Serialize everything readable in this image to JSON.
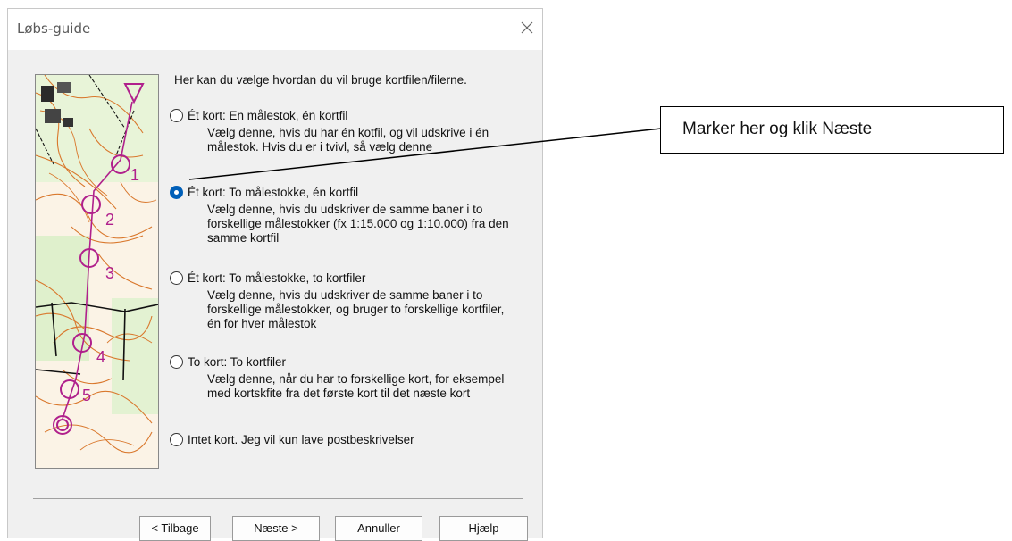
{
  "window": {
    "title": "Løbs-guide"
  },
  "intro": "Her kan du vælge hvordan du vil bruge kortfilen/filerne.",
  "options": [
    {
      "label": "Ét kort: En målestok, én kortfil",
      "desc": "Vælg denne, hvis du har én kotfil, og vil udskrive i én målestok.  Hvis du er i tvivl, så vælg denne",
      "selected": false
    },
    {
      "label": "Ét kort: To målestokke, én kortfil",
      "desc": "Vælg denne, hvis du udskriver de samme baner i to forskellige målestokker (fx 1:15.000 og 1:10.000) fra den samme kortfil",
      "selected": true
    },
    {
      "label": "Ét kort: To målestokke, to kortfiler",
      "desc": "Vælg denne, hvis du udskriver de samme baner i to forskellige målestokker, og bruger to forskellige kortfiler, én for hver målestok",
      "selected": false
    },
    {
      "label": "To kort: To kortfiler",
      "desc": "Vælg denne, når du har to forskellige kort, for eksempel med kortskfite fra det første kort til det næste kort",
      "selected": false
    },
    {
      "label": "Intet kort.  Jeg vil kun lave postbeskrivelser",
      "desc": "",
      "selected": false
    }
  ],
  "buttons": {
    "back": "< Tilbage",
    "next": "Næste >",
    "cancel": "Annuller",
    "help": "Hjælp"
  },
  "callout": "Marker her og klik Næste",
  "map_labels": [
    "1",
    "2",
    "3",
    "4",
    "5"
  ],
  "colors": {
    "accent": "#005fb8",
    "course": "#b0208c",
    "contour": "#d9782d"
  }
}
